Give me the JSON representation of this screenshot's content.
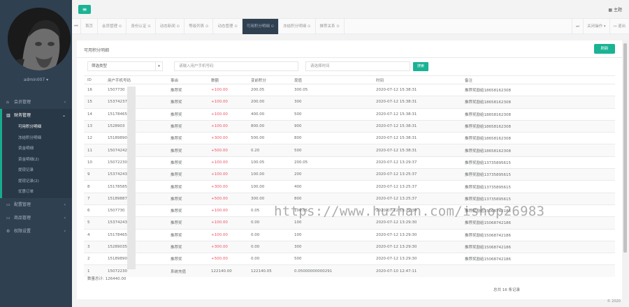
{
  "sidebar": {
    "user_name": "admin007 ▾",
    "items": [
      {
        "icon": "home-icon",
        "glyph": "⌂",
        "label": "会员管理",
        "arrow": "‹"
      },
      {
        "icon": "table-icon",
        "glyph": "▥",
        "label": "财务管理",
        "arrow": "⌄"
      },
      {
        "icon": "monitor-icon",
        "glyph": "▭",
        "label": "配置管理",
        "arrow": "‹"
      },
      {
        "icon": "monitor-icon",
        "glyph": "▭",
        "label": "商品管理",
        "arrow": "‹"
      },
      {
        "icon": "gear-icon",
        "glyph": "⚙",
        "label": "权限设置",
        "arrow": "‹"
      }
    ],
    "sub_items": [
      "可用积分明细",
      "冻结积分明细",
      "资金明细",
      "资金明细(2)",
      "提现记录",
      "提现记录(2)",
      "优惠订单"
    ]
  },
  "topbar": {
    "menu_glyph": "≡",
    "theme_label": "▦ 主题"
  },
  "tabs": {
    "left_glyph": "⏮",
    "right_glyph": "⏭",
    "items": [
      {
        "label": "首页",
        "active": false
      },
      {
        "label": "会员管理 ⊙",
        "active": false
      },
      {
        "label": "身份认证 ⊙",
        "active": false
      },
      {
        "label": "动态新闻 ⊙",
        "active": false
      },
      {
        "label": "等级列表 ⊙",
        "active": false
      },
      {
        "label": "动态管理 ⊙",
        "active": false
      },
      {
        "label": "可用积分明细 ⊙",
        "active": true
      },
      {
        "label": "冻结积分明细 ⊙",
        "active": false
      },
      {
        "label": "推荐关系 ⊙",
        "active": false
      }
    ],
    "close_ops": "关闭操作 ▾",
    "exit": "↦ 退出"
  },
  "page": {
    "title": "可用积分明细",
    "refresh": "刷新",
    "filter_select": "筛选类型",
    "filter_phone_placeholder": "请输入用户手机号码",
    "filter_time_placeholder": "请选择时间",
    "search": "搜索"
  },
  "table": {
    "headers": [
      "ID",
      "用户手机号码",
      "事由",
      "数额",
      "变前积分",
      "现值",
      "时间",
      "备注"
    ],
    "rows": [
      [
        "16",
        "1507730",
        "推荐奖",
        "+100.00",
        "200.05",
        "300.05",
        "2020-07-12 15:38:31",
        "推荐奖励给18658162308"
      ],
      [
        "15",
        "15374237",
        "推荐奖",
        "+100.00",
        "200.00",
        "300",
        "2020-07-12 15:38:31",
        "推荐奖励给18658162308"
      ],
      [
        "14",
        "15178465",
        "推荐奖",
        "+100.00",
        "400.00",
        "500",
        "2020-07-12 15:38:31",
        "推荐奖励给18658162308"
      ],
      [
        "13",
        "1528903",
        "推荐奖",
        "+100.00",
        "800.00",
        "900",
        "2020-07-12 15:38:31",
        "推荐奖励给18658162308"
      ],
      [
        "12",
        "15189890",
        "推荐奖",
        "+300.00",
        "500.00",
        "800",
        "2020-07-12 15:38:31",
        "推荐奖励给18658162308"
      ],
      [
        "11",
        "15074242",
        "推荐奖",
        "+500.00",
        "0.20",
        "500",
        "2020-07-12 15:38:31",
        "推荐奖励给18658162308"
      ],
      [
        "10",
        "15072230",
        "推荐奖",
        "+100.00",
        "100.05",
        "200.05",
        "2020-07-12 13:29:37",
        "推荐奖励给13735895615"
      ],
      [
        "9",
        "15374243",
        "推荐奖",
        "+100.00",
        "100.00",
        "200",
        "2020-07-12 13:25:37",
        "推荐奖励给13735895615"
      ],
      [
        "8",
        "15178585",
        "推荐奖",
        "+300.00",
        "100.00",
        "400",
        "2020-07-12 13:25:37",
        "推荐奖励给13735895615"
      ],
      [
        "7",
        "15189887",
        "推荐奖",
        "+500.00",
        "300.00",
        "800",
        "2020-07-12 13:25:37",
        "推荐奖励给13735895615"
      ],
      [
        "6",
        "1507730",
        "推荐奖",
        "+100.00",
        "0.05",
        "100.05",
        "2020-07-12 13:29:30",
        "推荐奖励给15068742186"
      ],
      [
        "5",
        "15374243",
        "推荐奖",
        "+100.00",
        "0.00",
        "100",
        "2020-07-12 13:29:30",
        "推荐奖励给15068742186"
      ],
      [
        "4",
        "15178465",
        "推荐奖",
        "+100.00",
        "0.00",
        "100",
        "2020-07-12 13:29:30",
        "推荐奖励给15068742186"
      ],
      [
        "3",
        "15289035",
        "推荐奖",
        "+300.00",
        "0.00",
        "300",
        "2020-07-12 13:29:30",
        "推荐奖励给15068742186"
      ],
      [
        "2",
        "15189890",
        "推荐奖",
        "+500.00",
        "0.00",
        "500",
        "2020-07-12 13:29:30",
        "推荐奖励给15068742186"
      ],
      [
        "1",
        "15072230",
        "系统充值",
        "122140.00",
        "122140.05",
        "0.05000000000291",
        "2020-07-10 12:47:11",
        ""
      ]
    ]
  },
  "footer": {
    "total": "数量总计: 126440.00",
    "pages": "总共 16 条记录",
    "year": "© 2020"
  },
  "watermark": "https://www.huzhan.com/ishop26983"
}
